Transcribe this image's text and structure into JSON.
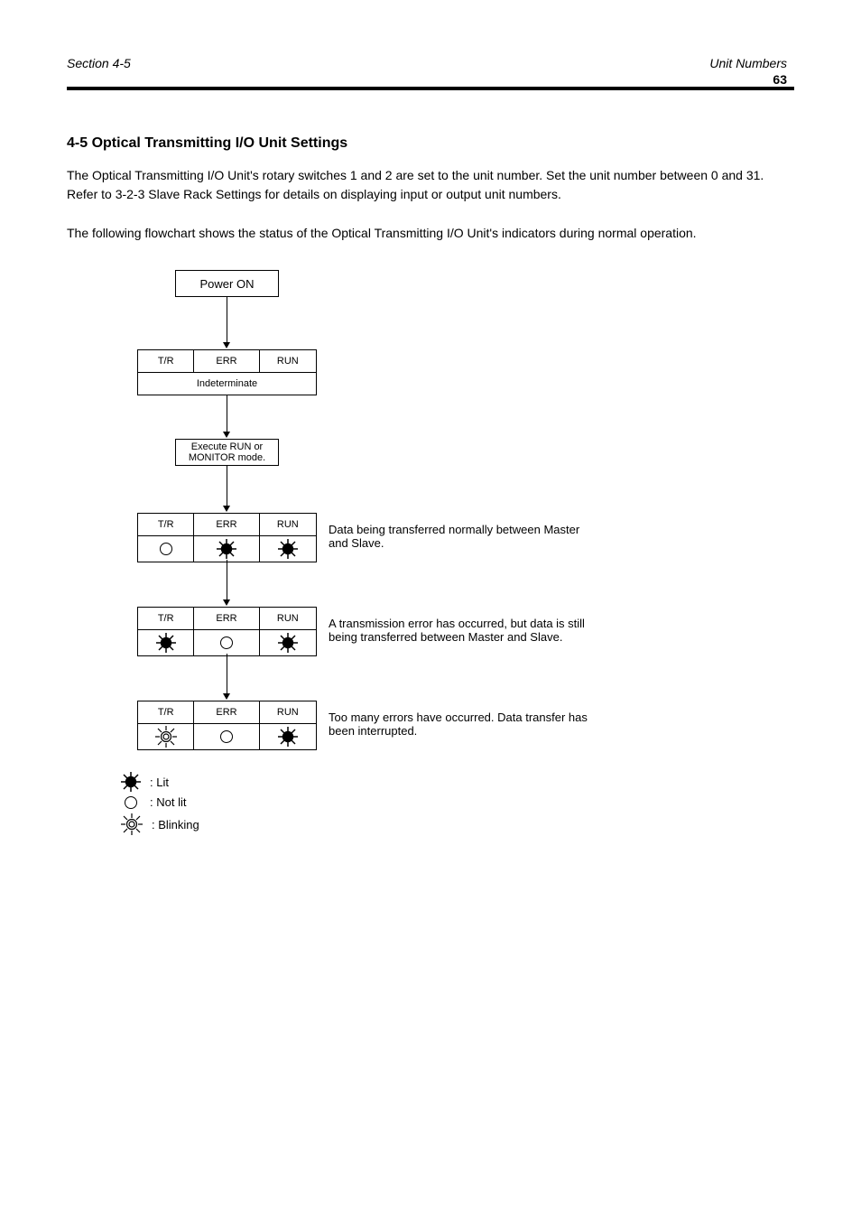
{
  "header": {
    "section": "Section 4-5",
    "right": "Unit Numbers",
    "page": "63"
  },
  "heading": "4-5    Optical Transmitting I/O Unit Settings",
  "intro": "The Optical Transmitting I/O Unit's rotary switches 1 and 2 are set to the unit number. Set the unit number between 0 and 31. Refer to 3-2-3 Slave Rack Settings for details on displaying input or output unit numbers.",
  "flow_intro": "The following flowchart shows the status of the Optical Transmitting I/O Unit's indicators during normal operation.",
  "flow": {
    "power_on": "Power ON",
    "table1": {
      "col1": "T/R",
      "col2": "ERR",
      "col3": "RUN"
    },
    "indet": "Indeterminate",
    "run_program": "Execute RUN or\nMONITOR mode.",
    "table2": {
      "col1": "T/R",
      "col2": "ERR",
      "col3": "RUN"
    },
    "side2": "Data being transferred normally between Master\nand Slave.",
    "table3": {
      "col1": "T/R",
      "col2": "ERR",
      "col3": "RUN"
    },
    "side3": "A transmission error has occurred, but data is still\nbeing transferred between Master and Slave.",
    "table4": {
      "col1": "T/R",
      "col2": "ERR",
      "col3": "RUN"
    },
    "side4": "Too many errors have occurred. Data transfer has\nbeen interrupted."
  },
  "legend": {
    "on": ": Lit",
    "off": ": Not lit",
    "blink": ": Blinking"
  }
}
